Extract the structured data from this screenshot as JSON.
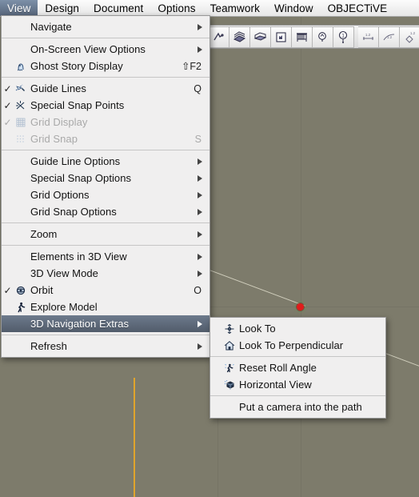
{
  "app": {
    "canvas_background": "#7d7b6b",
    "menu_background": "#f0efef",
    "highlight_color": "#5a6472",
    "guide_line_color": "#d8d6c4",
    "marker_color": "#e01b1b",
    "orange_line_color": "#e0a42c"
  },
  "menubar": {
    "items": [
      {
        "label": "View",
        "selected": true
      },
      {
        "label": "Design",
        "selected": false
      },
      {
        "label": "Document",
        "selected": false
      },
      {
        "label": "Options",
        "selected": false
      },
      {
        "label": "Teamwork",
        "selected": false
      },
      {
        "label": "Window",
        "selected": false
      },
      {
        "label": "OBJECTiVE",
        "selected": false
      }
    ]
  },
  "toolbar": {
    "buttons": [
      {
        "name": "trace-reference-icon"
      },
      {
        "name": "books-stack-icon"
      },
      {
        "name": "open-book-icon"
      },
      {
        "name": "hand-pointer-icon"
      },
      {
        "name": "building-icon"
      },
      {
        "name": "light-bulb-icon"
      },
      {
        "name": "zone-stamp-icon"
      },
      {
        "name": "dimension-icon"
      },
      {
        "name": "radial-dimension-icon"
      },
      {
        "name": "level-dimension-icon"
      },
      {
        "name": "coordinate-dimension-icon"
      }
    ]
  },
  "view_menu": {
    "groups": [
      {
        "items": [
          {
            "label": "Navigate",
            "check": "",
            "icon": "",
            "key": "",
            "submenu": true,
            "disabled": false,
            "highlighted": false
          }
        ]
      },
      {
        "items": [
          {
            "label": "On-Screen View Options",
            "check": "",
            "icon": "",
            "key": "",
            "submenu": true,
            "disabled": false,
            "highlighted": false
          },
          {
            "label": "Ghost Story Display",
            "check": "",
            "icon": "ghost-story-icon",
            "key": "⇧F2",
            "submenu": false,
            "disabled": false,
            "highlighted": false
          }
        ]
      },
      {
        "items": [
          {
            "label": "Guide Lines",
            "check": "✓",
            "icon": "guide-lines-icon",
            "key": "Q",
            "submenu": false,
            "disabled": false,
            "highlighted": false
          },
          {
            "label": "Special Snap Points",
            "check": "✓",
            "icon": "special-snap-icon",
            "key": "",
            "submenu": false,
            "disabled": false,
            "highlighted": false
          },
          {
            "label": "Grid Display",
            "check": "✓",
            "icon": "grid-display-icon",
            "key": "",
            "submenu": false,
            "disabled": true,
            "highlighted": false
          },
          {
            "label": "Grid Snap",
            "check": "",
            "icon": "grid-snap-icon",
            "key": "S",
            "submenu": false,
            "disabled": true,
            "highlighted": false
          }
        ]
      },
      {
        "items": [
          {
            "label": "Guide Line Options",
            "check": "",
            "icon": "",
            "key": "",
            "submenu": true,
            "disabled": false,
            "highlighted": false
          },
          {
            "label": "Special Snap Options",
            "check": "",
            "icon": "",
            "key": "",
            "submenu": true,
            "disabled": false,
            "highlighted": false
          },
          {
            "label": "Grid Options",
            "check": "",
            "icon": "",
            "key": "",
            "submenu": true,
            "disabled": false,
            "highlighted": false
          },
          {
            "label": "Grid Snap Options",
            "check": "",
            "icon": "",
            "key": "",
            "submenu": true,
            "disabled": false,
            "highlighted": false
          }
        ]
      },
      {
        "items": [
          {
            "label": "Zoom",
            "check": "",
            "icon": "",
            "key": "",
            "submenu": true,
            "disabled": false,
            "highlighted": false
          }
        ]
      },
      {
        "items": [
          {
            "label": "Elements in 3D View",
            "check": "",
            "icon": "",
            "key": "",
            "submenu": true,
            "disabled": false,
            "highlighted": false
          },
          {
            "label": "3D View Mode",
            "check": "",
            "icon": "",
            "key": "",
            "submenu": true,
            "disabled": false,
            "highlighted": false
          },
          {
            "label": "Orbit",
            "check": "✓",
            "icon": "orbit-icon",
            "key": "O",
            "submenu": false,
            "disabled": false,
            "highlighted": false
          },
          {
            "label": "Explore Model",
            "check": "",
            "icon": "explore-model-icon",
            "key": "",
            "submenu": false,
            "disabled": false,
            "highlighted": false
          },
          {
            "label": "3D Navigation Extras",
            "check": "",
            "icon": "",
            "key": "",
            "submenu": true,
            "disabled": false,
            "highlighted": true
          }
        ]
      },
      {
        "items": [
          {
            "label": "Refresh",
            "check": "",
            "icon": "",
            "key": "",
            "submenu": true,
            "disabled": false,
            "highlighted": false
          }
        ]
      }
    ]
  },
  "navigation_extras_submenu": {
    "groups": [
      {
        "items": [
          {
            "label": "Look To",
            "icon": "look-to-icon",
            "disabled": false
          },
          {
            "label": "Look To Perpendicular",
            "icon": "look-to-perpendicular-icon",
            "disabled": false
          }
        ]
      },
      {
        "items": [
          {
            "label": "Reset Roll Angle",
            "icon": "reset-roll-angle-icon",
            "disabled": false
          },
          {
            "label": "Horizontal View",
            "icon": "horizontal-view-icon",
            "disabled": false
          }
        ]
      },
      {
        "items": [
          {
            "label": "Put a camera into the path",
            "icon": "",
            "disabled": false
          }
        ]
      }
    ]
  }
}
